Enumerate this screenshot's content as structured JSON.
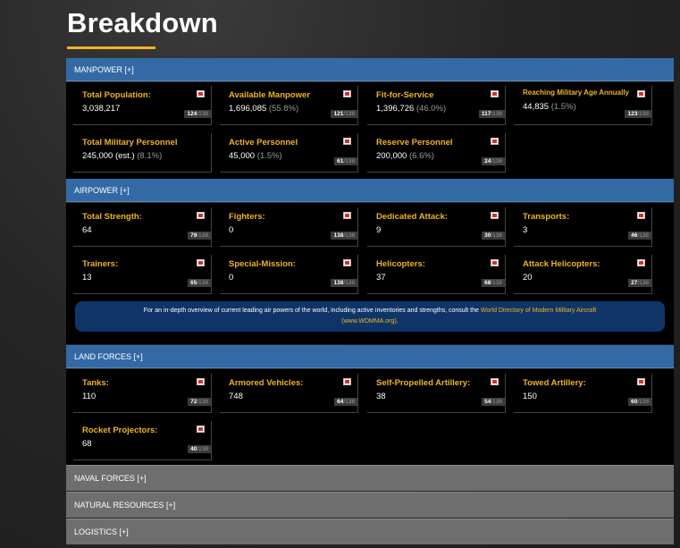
{
  "page": {
    "title": "Breakdown"
  },
  "colors": {
    "accent": "#f0b323",
    "section_blue": "#336aa5",
    "section_gray": "#6e6e6e",
    "info_box": "#0f3568"
  },
  "sections": {
    "manpower": {
      "header": "MANPOWER [+]",
      "cards": [
        {
          "label": "Total Population:",
          "value": "3,038,217",
          "pct": "",
          "rank": "124",
          "of": "/138"
        },
        {
          "label": "Available Manpower",
          "value": "1,696,085",
          "pct": "(55.8%)",
          "rank": "121",
          "of": "/138"
        },
        {
          "label": "Fit-for-Service",
          "value": "1,396,726",
          "pct": "(46.0%)",
          "rank": "117",
          "of": "/138"
        },
        {
          "label": "Reaching Military Age Annually",
          "value": "44,835",
          "pct": "(1.5%)",
          "rank": "123",
          "of": "/138"
        },
        {
          "label": "Total Military Personnel",
          "value": "245,000 (est.)",
          "pct": "(8.1%)",
          "rank": "",
          "of": ""
        },
        {
          "label": "Active Personnel",
          "value": "45,000",
          "pct": "(1.5%)",
          "rank": "61",
          "of": "/138"
        },
        {
          "label": "Reserve Personnel",
          "value": "200,000",
          "pct": "(6.6%)",
          "rank": "24",
          "of": "/138"
        }
      ]
    },
    "airpower": {
      "header": "AIRPOWER [+]",
      "cards": [
        {
          "label": "Total Strength:",
          "value": "64",
          "rank": "79",
          "of": "/138"
        },
        {
          "label": "Fighters:",
          "value": "0",
          "rank": "138",
          "of": "/138"
        },
        {
          "label": "Dedicated Attack:",
          "value": "9",
          "rank": "30",
          "of": "/138"
        },
        {
          "label": "Transports:",
          "value": "3",
          "rank": "46",
          "of": "/138"
        },
        {
          "label": "Trainers:",
          "value": "13",
          "rank": "65",
          "of": "/138"
        },
        {
          "label": "Special-Mission:",
          "value": "0",
          "rank": "138",
          "of": "/138"
        },
        {
          "label": "Helicopters:",
          "value": "37",
          "rank": "68",
          "of": "/138"
        },
        {
          "label": "Attack Helicopters:",
          "value": "20",
          "rank": "27",
          "of": "/138"
        }
      ],
      "info_text_1": "For an in-depth overview of current leading air powers of the world, including active inventories and strengths, consult the ",
      "info_link": "World Directory of Modern Military Aircraft",
      "info_link_2": "(www.WDMMA.org)",
      "info_text_2": "."
    },
    "land_forces": {
      "header": "LAND FORCES [+]",
      "cards": [
        {
          "label": "Tanks:",
          "value": "110",
          "rank": "72",
          "of": "/138"
        },
        {
          "label": "Armored Vehicles:",
          "value": "748",
          "rank": "64",
          "of": "/138"
        },
        {
          "label": "Self-Propelled Artillery:",
          "value": "38",
          "rank": "54",
          "of": "/138"
        },
        {
          "label": "Towed Artillery:",
          "value": "150",
          "rank": "60",
          "of": "/138"
        },
        {
          "label": "Rocket Projectors:",
          "value": "68",
          "rank": "40",
          "of": "/138"
        }
      ]
    },
    "naval_forces": {
      "header": "NAVAL FORCES [+]"
    },
    "natural_resources": {
      "header": "NATURAL RESOURCES [+]"
    },
    "logistics": {
      "header": "LOGISTICS [+]"
    }
  }
}
